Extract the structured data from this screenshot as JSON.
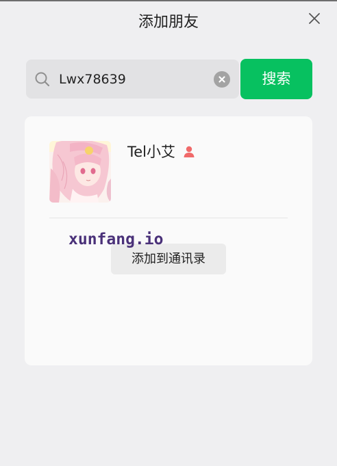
{
  "window": {
    "title": "添加朋友",
    "close_icon": "close-icon"
  },
  "search": {
    "value": "Lwx78639",
    "search_icon": "search-icon",
    "clear_icon": "clear-icon",
    "button_label": "搜索"
  },
  "result": {
    "avatar": "anime-avatar",
    "nickname": "Tel小艾",
    "gender_icon": "female-icon",
    "add_button_label": "添加到通讯录"
  },
  "watermark": {
    "text": "xunfang.io"
  },
  "colors": {
    "background": "#efeff1",
    "accent": "#07c160",
    "card": "#fafafa",
    "female": "#f06a6a",
    "watermark": "#4a3179"
  }
}
